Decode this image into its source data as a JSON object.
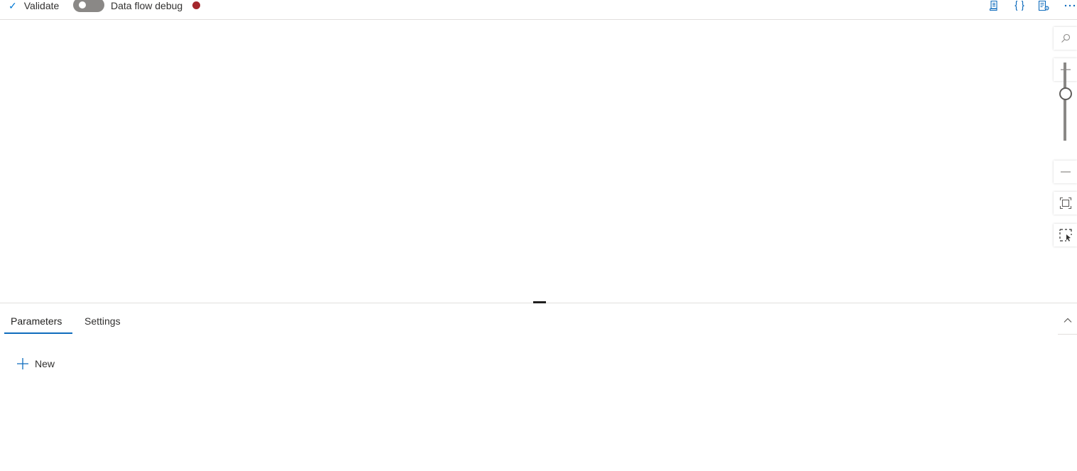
{
  "toolbar": {
    "validate_label": "Validate",
    "debug_label": "Data flow debug",
    "debug_enabled": false,
    "status_color": "#a4262c",
    "right_icons": [
      "script-icon",
      "code-braces-icon",
      "properties-icon",
      "more-options-icon"
    ]
  },
  "canvas_controls": {
    "icons": [
      "search-icon",
      "zoom-in-icon",
      "zoom-out-icon",
      "fit-to-screen-icon",
      "select-area-icon"
    ],
    "zoom_level_fraction": 0.6
  },
  "bottom_panel": {
    "tabs": [
      {
        "label": "Parameters",
        "active": true
      },
      {
        "label": "Settings",
        "active": false
      }
    ],
    "new_label": "New"
  },
  "colors": {
    "accent": "#0f6cbd",
    "toggle_off": "#8a8886",
    "status_dot": "#a4262c"
  }
}
